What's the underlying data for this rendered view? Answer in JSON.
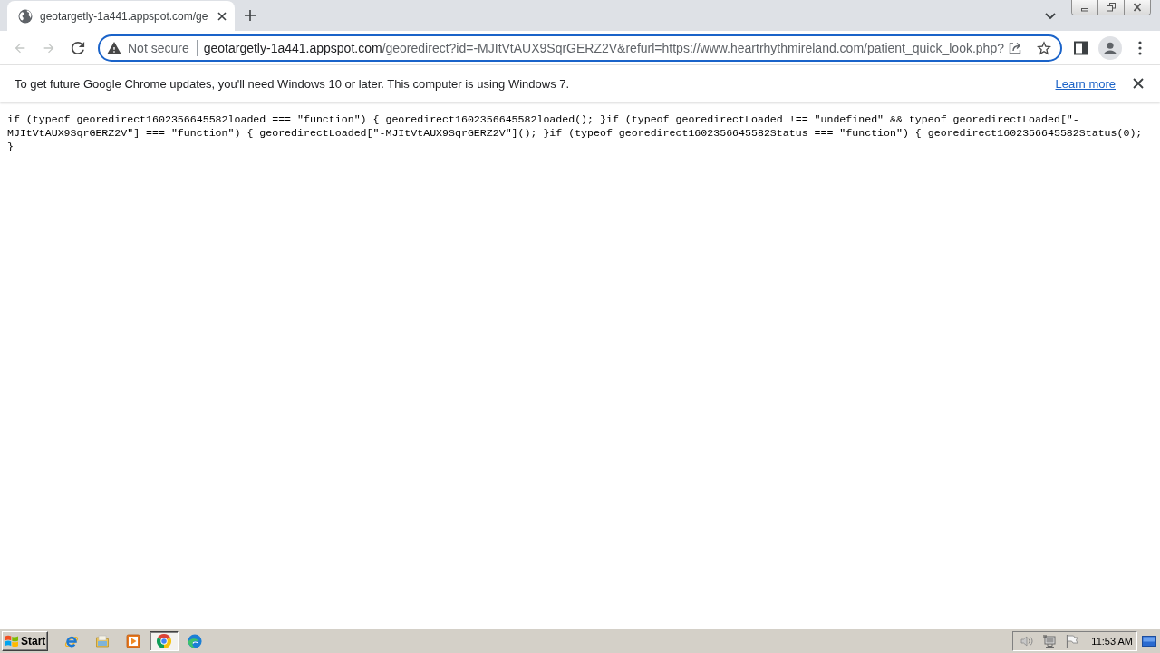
{
  "tabs": [
    {
      "title": "geotargetly-1a441.appspot.com/ge",
      "selected": true
    }
  ],
  "toolbar": {
    "back_disabled": true,
    "forward_disabled": true
  },
  "omnibox": {
    "security_label": "Not secure",
    "url_host": "geotargetly-1a441.appspot.com",
    "url_path": "/georedirect?id=-MJItVtAUX9SqrGERZ2V&refurl=https://www.heartrhythmireland.com/patient_quick_look.php?"
  },
  "infobar": {
    "message": "To get future Google Chrome updates, you'll need Windows 10 or later. This computer is using Windows 7.",
    "link": "Learn more"
  },
  "page_text": "if (typeof georedirect1602356645582loaded === \"function\") { georedirect1602356645582loaded(); }if (typeof georedirectLoaded !== \"undefined\" && typeof georedirectLoaded[\"-MJItVtAUX9SqrGERZ2V\"] === \"function\") { georedirectLoaded[\"-MJItVtAUX9SqrGERZ2V\"](); }if (typeof georedirect1602356645582Status === \"function\") { georedirect1602356645582Status(0); }",
  "taskbar": {
    "start_label": "Start",
    "apps": [
      {
        "kind": "ie",
        "selected": false
      },
      {
        "kind": "explorer",
        "selected": false
      },
      {
        "kind": "player",
        "selected": false
      },
      {
        "kind": "chrome",
        "selected": true
      },
      {
        "kind": "edge",
        "selected": false
      }
    ],
    "clock": "11:53 AM"
  }
}
